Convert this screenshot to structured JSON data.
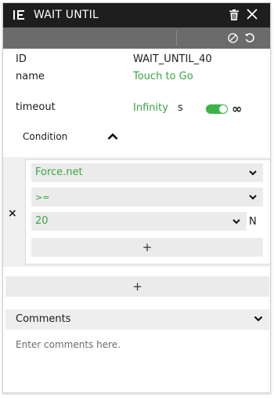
{
  "window": {
    "title": "WAIT UNTIL"
  },
  "icons": {
    "block": "wait-until-icon",
    "delete": "trash-icon",
    "close": "close-icon",
    "disable": "ban-icon",
    "reset": "undo-icon",
    "expand": "chevron-up-icon",
    "dropdown": "chevron-down-icon",
    "remove": "close-icon",
    "add": "plus-icon"
  },
  "colors": {
    "accent": "#3aa445",
    "titlebar": "#1e1e1e",
    "toolbar": "#6b6b6b",
    "toggle_on": "#3cb44a"
  },
  "props": {
    "id_label": "ID",
    "id_value": "WAIT_UNTIL_40",
    "name_label": "name",
    "name_value": "Touch to Go",
    "timeout_label": "timeout",
    "timeout_value": "Infinity",
    "timeout_unit": "s",
    "infinity_toggle_on": true,
    "infinity_symbol": "∞"
  },
  "condition": {
    "label": "Condition",
    "remove_symbol": "×",
    "signal": "Force.net",
    "operator": ">=",
    "threshold": "20",
    "threshold_unit": "N",
    "add_symbol": "+"
  },
  "add_condition_symbol": "+",
  "comments": {
    "label": "Comments",
    "placeholder": "Enter comments here."
  }
}
